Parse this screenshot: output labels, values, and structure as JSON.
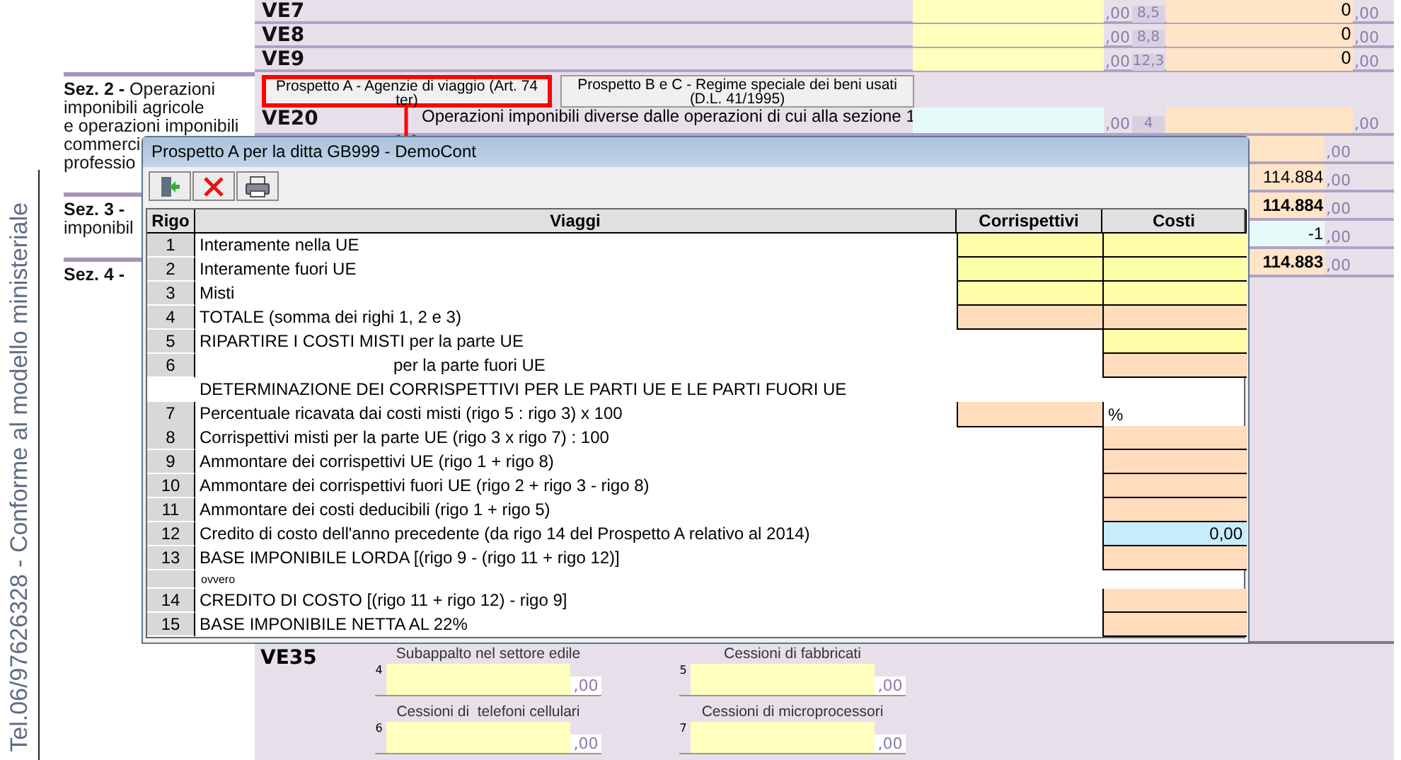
{
  "side_label": "Tel.06/97626328 - Conforme al modello ministeriale",
  "sections": [
    {
      "lines": [
        "**Sez. 2 -** Operazioni",
        "imponibili agricole",
        "e operazioni imponibili",
        "commerci",
        "professio"
      ]
    },
    {
      "lines": [
        "**Sez. 3 -**",
        "imponibil"
      ]
    },
    {
      "lines": [
        "**Sez. 4 -**"
      ]
    }
  ],
  "form": {
    "rows": [
      {
        "code": "VE7",
        "base": {
          "kind": "input",
          "decimals": ",00"
        },
        "rate": "8,5",
        "tax": {
          "kind": "computed",
          "value": "0",
          "decimals": ",00"
        }
      },
      {
        "code": "VE8",
        "base": {
          "kind": "input",
          "decimals": ",00"
        },
        "rate": "8,8",
        "tax": {
          "kind": "computed",
          "value": "0",
          "decimals": ",00"
        }
      },
      {
        "code": "VE9",
        "base": {
          "kind": "input",
          "decimals": ",00"
        },
        "rate": "12,3",
        "tax": {
          "kind": "computed",
          "value": "0",
          "decimals": ",00"
        }
      }
    ],
    "tabs": [
      {
        "label": "Prospetto A - Agenzie di viaggio (Art. 74 ter)",
        "highlighted": true
      },
      {
        "label": "Prospetto B e C - Regime speciale dei beni usati (D.L. 41/1995)",
        "highlighted": false
      }
    ],
    "ve20": {
      "code": "VE20",
      "description": "Operazioni imponibili diverse dalle operazioni di cui alla sezione 1",
      "base": {
        "kind": "imported",
        "decimals": ",00"
      },
      "rate": "4",
      "tax": {
        "kind": "computed",
        "decimals": ",00"
      }
    },
    "totals": [
      {
        "kind": "computed",
        "decimals": ",00"
      },
      {
        "kind": "computed",
        "bold": false,
        "value": "114.884",
        "decimals": ",00"
      },
      {
        "kind": "computed",
        "bold": true,
        "value": "114.884",
        "decimals": ",00"
      },
      {
        "kind": "imported",
        "bold": false,
        "value": "-1",
        "decimals": ",00"
      },
      {
        "kind": "computed",
        "bold": true,
        "value": "114.883",
        "decimals": ",00"
      }
    ],
    "ve35": {
      "code": "VE35",
      "fields": [
        {
          "label": "Subappalto nel settore edile",
          "number": "4",
          "decimals": ",00"
        },
        {
          "label": "Cessioni di fabbricati",
          "number": "5",
          "decimals": ",00"
        },
        {
          "label": "Cessioni di  telefoni cellulari",
          "number": "6",
          "decimals": ",00"
        },
        {
          "label": "Cessioni di microprocessori",
          "number": "7",
          "decimals": ",00"
        }
      ]
    }
  },
  "dialog": {
    "title": "Prospetto A per la ditta GB999 -  DemoCont",
    "toolbar": [
      {
        "kind": "exit"
      },
      {
        "kind": "delete"
      },
      {
        "kind": "print"
      }
    ],
    "columns": [
      "Rigo",
      "Viaggi",
      "Corrispettivi",
      "Costi"
    ],
    "rows": [
      {
        "kind": "line",
        "rigo": "1",
        "label": "Interamente nella UE",
        "cells": [
          {
            "kind": "input"
          },
          {
            "kind": "input"
          }
        ]
      },
      {
        "kind": "line",
        "rigo": "2",
        "label": "Interamente fuori UE",
        "cells": [
          {
            "kind": "input"
          },
          {
            "kind": "input"
          }
        ]
      },
      {
        "kind": "line",
        "rigo": "3",
        "label": "Misti",
        "cells": [
          {
            "kind": "input"
          },
          {
            "kind": "input"
          }
        ]
      },
      {
        "kind": "line",
        "rigo": "4",
        "label": "TOTALE (somma dei righi 1, 2 e 3)",
        "cells": [
          {
            "kind": "computed"
          },
          {
            "kind": "computed"
          }
        ]
      },
      {
        "kind": "line",
        "rigo": "5",
        "label": "RIPARTIRE I COSTI MISTI per la parte UE",
        "cells": [
          {
            "kind": "none"
          },
          {
            "kind": "input"
          }
        ]
      },
      {
        "kind": "line",
        "rigo": "6",
        "label": "per la parte fuori UE",
        "continuation": true,
        "cells": [
          {
            "kind": "none"
          },
          {
            "kind": "computed"
          }
        ]
      },
      {
        "kind": "heading",
        "label": "DETERMINAZIONE DEI CORRISPETTIVI PER LE PARTI UE E LE PARTI FUORI UE"
      },
      {
        "kind": "line",
        "rigo": "7",
        "label": "Percentuale ricavata dai costi misti (rigo 5 : rigo 3) x 100",
        "cells": [
          {
            "kind": "computed"
          },
          {
            "kind": "unit",
            "value": "%"
          }
        ]
      },
      {
        "kind": "line",
        "rigo": "8",
        "label": "Corrispettivi misti per la parte UE (rigo 3 x rigo 7) : 100",
        "cells": [
          {
            "kind": "none"
          },
          {
            "kind": "computed"
          }
        ]
      },
      {
        "kind": "line",
        "rigo": "9",
        "label": "Ammontare dei corrispettivi UE (rigo 1 + rigo 8)",
        "cells": [
          {
            "kind": "none"
          },
          {
            "kind": "computed"
          }
        ]
      },
      {
        "kind": "line",
        "rigo": "10",
        "label": "Ammontare dei corrispettivi fuori UE (rigo 2 + rigo 3 - rigo 8)",
        "cells": [
          {
            "kind": "none"
          },
          {
            "kind": "computed"
          }
        ]
      },
      {
        "kind": "line",
        "rigo": "11",
        "label": "Ammontare dei costi deducibili (rigo 1 + rigo 5)",
        "cells": [
          {
            "kind": "none"
          },
          {
            "kind": "computed"
          }
        ]
      },
      {
        "kind": "line",
        "rigo": "12",
        "label": "Credito di costo dell'anno precedente (da rigo 14 del Prospetto A relativo al 2014)",
        "cells": [
          {
            "kind": "none"
          },
          {
            "kind": "imported",
            "value": "0,00"
          }
        ]
      },
      {
        "kind": "line",
        "rigo": "13",
        "label": "BASE IMPONIBILE LORDA [(rigo 9 - (rigo 11 + rigo 12)]",
        "cells": [
          {
            "kind": "none"
          },
          {
            "kind": "computed"
          }
        ]
      },
      {
        "kind": "note",
        "label": "ovvero"
      },
      {
        "kind": "line",
        "rigo": "14",
        "label": "CREDITO DI COSTO [(rigo 11 + rigo 12) - rigo 9]",
        "cells": [
          {
            "kind": "none"
          },
          {
            "kind": "computed"
          }
        ]
      },
      {
        "kind": "line",
        "rigo": "15",
        "label": "BASE IMPONIBILE NETTA AL 22%",
        "cells": [
          {
            "kind": "none"
          },
          {
            "kind": "computed"
          }
        ]
      }
    ]
  }
}
